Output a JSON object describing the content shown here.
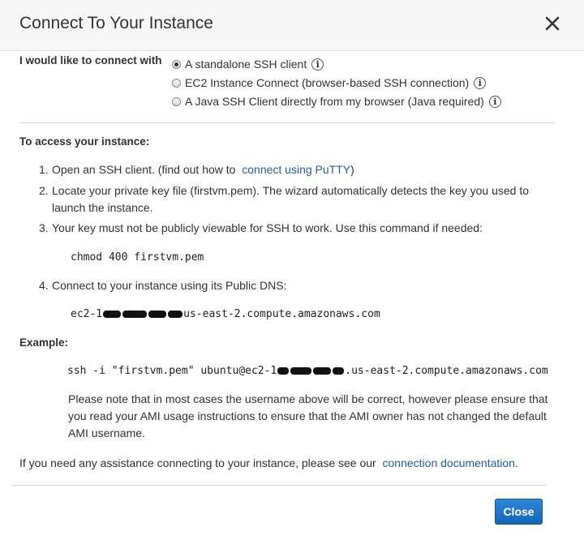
{
  "dialog": {
    "title": "Connect To Your Instance",
    "close_button": "Close"
  },
  "connection_method": {
    "label": "I would like to connect with",
    "options": [
      {
        "label": "A standalone SSH client",
        "selected": true
      },
      {
        "label": "EC2 Instance Connect (browser-based SSH connection)",
        "selected": false
      },
      {
        "label": "A Java SSH Client directly from my browser (Java required)",
        "selected": false
      }
    ],
    "info_glyph": "i"
  },
  "instructions": {
    "heading": "To access your instance:",
    "steps": [
      {
        "num": "1.",
        "text": "Open an SSH client. (find out how to",
        "link": "connect using PuTTY",
        "suffix": ")"
      },
      {
        "num": "2.",
        "text": "Locate your private key file (firstvm.pem). The wizard automatically detects the key you used to launch the instance."
      },
      {
        "num": "3.",
        "text": "Your key must not be publicly viewable for SSH to work. Use this command if needed:"
      },
      {
        "num": "4.",
        "text": "Connect to your instance using its Public DNS:"
      }
    ],
    "chmod_command": "chmod 400 firstvm.pem",
    "dns_prefix": "ec2-1",
    "dns_suffix": "us-east-2.compute.amazonaws.com"
  },
  "example": {
    "heading": "Example:",
    "ssh_prefix": "ssh -i \"firstvm.pem\" ubuntu@ec2-1",
    "ssh_suffix": ".us-east-2.compute.amazonaws.com",
    "note": "Please note that in most cases the username above will be correct, however please ensure that you read your AMI usage instructions to ensure that the AMI owner has not changed the default AMI username."
  },
  "help": {
    "text": "If you need any assistance connecting to your instance, please see our",
    "link": "connection documentation",
    "suffix": "."
  }
}
